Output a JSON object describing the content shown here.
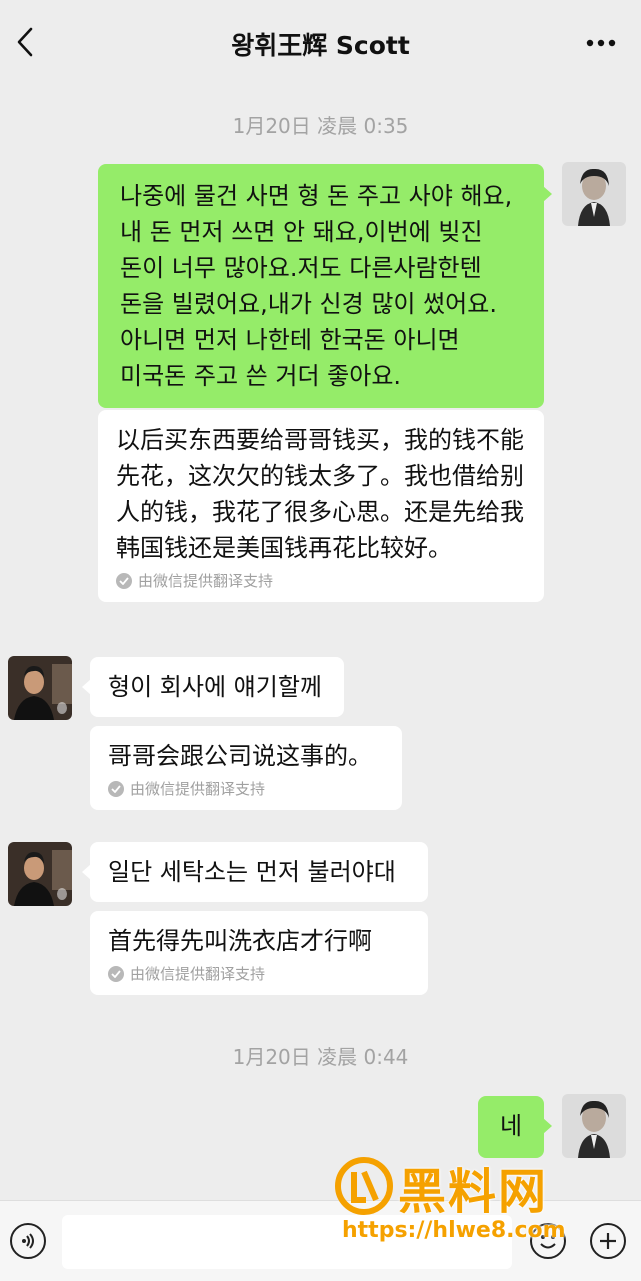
{
  "header": {
    "title": "왕휘王辉 Scott"
  },
  "messages": {
    "timestamp_1": "1月20日 凌晨 0:35",
    "m1": {
      "text": "나중에 물건 사면 형 돈 주고 사야 해요, 내 돈 먼저 쓰면 안 돼요,이번에 빚진 돈이 너무 많아요.저도 다른사람한텐 돈을 빌렸어요,내가 신경 많이 썼어요. 아니면 먼저 나한테 한국돈 아니면 미국돈 주고 쓴 거더 좋아요.",
      "translation": "以后买东西要给哥哥钱买，我的钱不能先花，这次欠的钱太多了。我也借给别人的钱，我花了很多心思。还是先给我韩国钱还是美国钱再花比较好。",
      "translation_note": "由微信提供翻译支持"
    },
    "m2": {
      "text": "형이 회사에 얘기할께",
      "translation": "哥哥会跟公司说这事的。",
      "translation_note": "由微信提供翻译支持"
    },
    "m3": {
      "text": "일단 세탁소는 먼저 불러야대",
      "translation": "首先得先叫洗衣店才行啊",
      "translation_note": "由微信提供翻译支持"
    },
    "timestamp_2": "1月20日 凌晨 0:44",
    "m4": {
      "text": "네"
    }
  },
  "input": {
    "value": ""
  },
  "watermark": {
    "title": "黑料网",
    "url": "https://hlwe8.com"
  },
  "colors": {
    "background": "#ededed",
    "sent_bubble": "#95ec69",
    "received_bubble": "#ffffff",
    "watermark": "#f5a100"
  },
  "icons": [
    "back-arrow-icon",
    "more-dots-icon",
    "voice-icon",
    "emoji-icon",
    "plus-icon",
    "check-circle-icon"
  ]
}
